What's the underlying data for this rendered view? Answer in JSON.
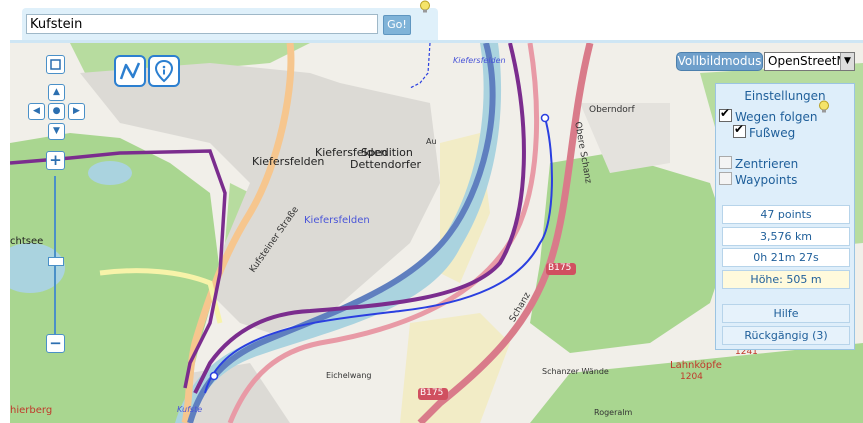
{
  "search": {
    "value": "Kufstein",
    "go_label": "Go!"
  },
  "toolbar": {
    "fullscreen_label": "Vollbildmodus",
    "layer_selected": "OpenStreetMa"
  },
  "panel": {
    "title": "Einstellungen",
    "options": [
      {
        "label": "Wegen folgen",
        "checked": true
      },
      {
        "label": "Fußweg",
        "checked": true
      },
      {
        "label": "Zentrieren",
        "checked": false
      },
      {
        "label": "Waypoints",
        "checked": false
      }
    ],
    "stats": {
      "points": "47 points",
      "distance": "3,576 km",
      "duration": "0h 21m 27s",
      "height": "Höhe: 505 m"
    },
    "help_label": "Hilfe",
    "undo_label": "Rückgängig (3)"
  },
  "map": {
    "labels": {
      "kiefersfelden_west": "Kiefersfelden",
      "kiefersfelden_mid": "Kiefersfelden",
      "kiefersfelden_blue": "Kiefersfelden",
      "kiefersfelden_top": "Kiefersfelden",
      "spedition_1": "Spedition",
      "spedition_2": "Dettendorfer",
      "au": "Au",
      "oberndorf": "Oberndorf",
      "kufsteiner_strasse": "Kufsteiner Straße",
      "schanz": "Schanz",
      "obere_schanz": "Obere Schanz",
      "eichelwang": "Eichelwang",
      "schanzer_waende": "Schanzer Wände",
      "rogeralm": "Rogeralm",
      "lahnkoepfe": "Lahnköpfe",
      "lahnkoepfe_elev": "1204",
      "elev_1241": "1241",
      "b175_a": "B175",
      "b175_b": "B175",
      "chtsee": "chtsee",
      "hierberg": "hierberg",
      "kufstein_bottom": "Kufste"
    },
    "colors": {
      "track": "#2a3fe0",
      "route": "#7b2d8e",
      "road_main": "#d97b8a",
      "river": "#4f74b8",
      "forest": "#a9d690"
    }
  }
}
